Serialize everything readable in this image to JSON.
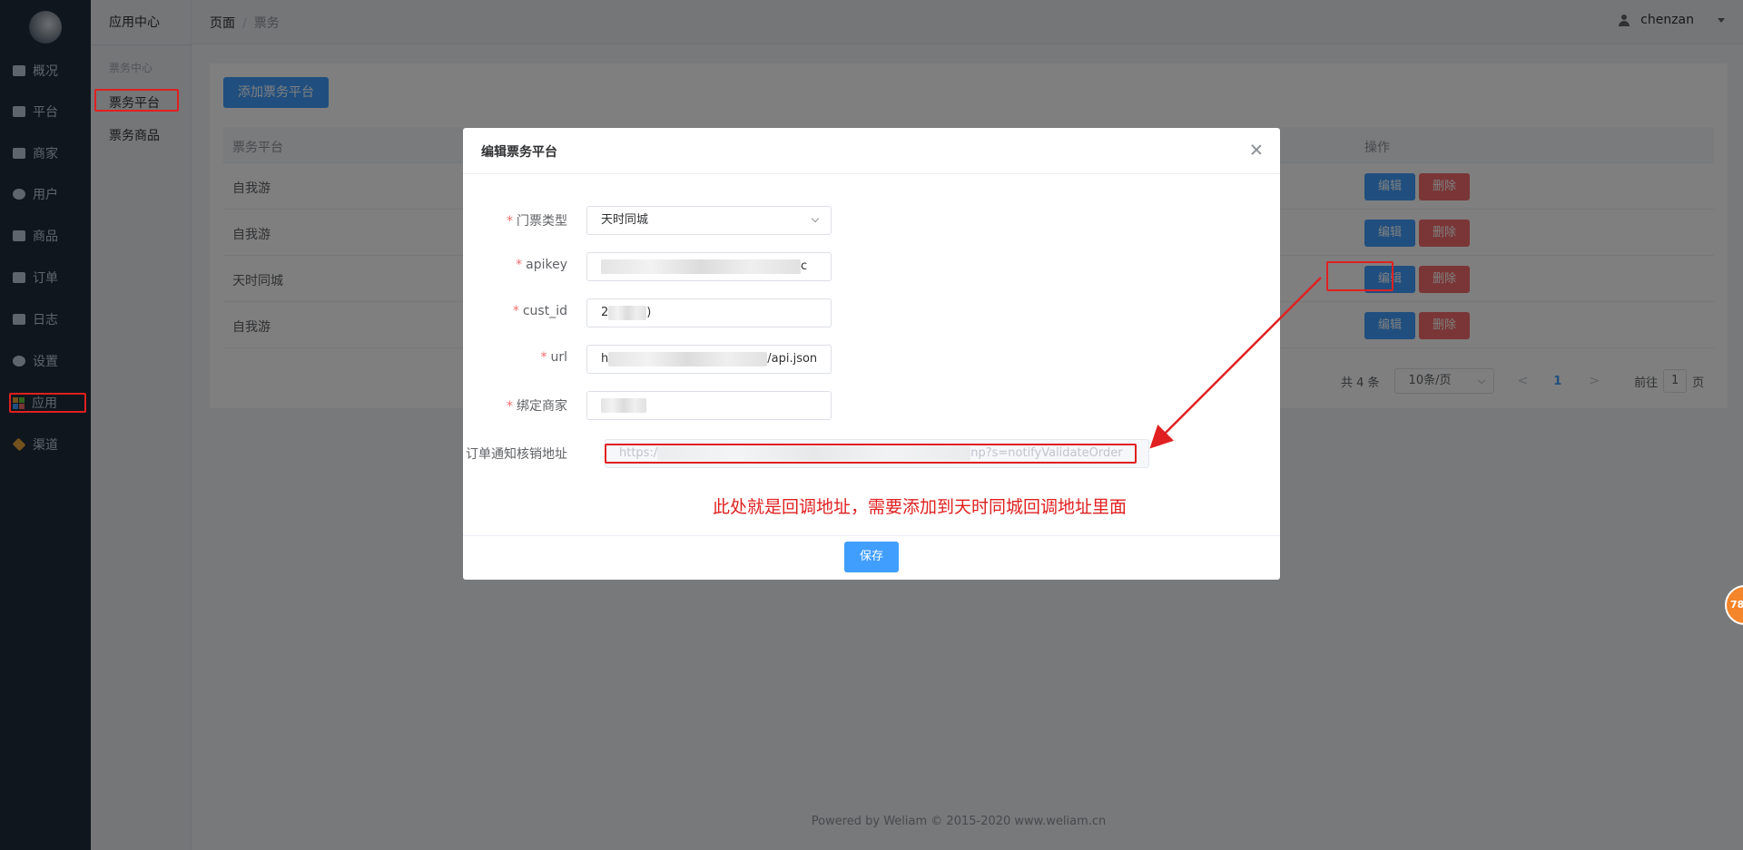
{
  "nav": {
    "items": [
      {
        "label": "概况",
        "icon": "chart-icon"
      },
      {
        "label": "平台",
        "icon": "monitor-icon"
      },
      {
        "label": "商家",
        "icon": "store-icon"
      },
      {
        "label": "用户",
        "icon": "user-icon"
      },
      {
        "label": "商品",
        "icon": "goods-icon"
      },
      {
        "label": "订单",
        "icon": "order-icon"
      },
      {
        "label": "日志",
        "icon": "log-icon"
      },
      {
        "label": "设置",
        "icon": "gear-icon"
      },
      {
        "label": "应用",
        "icon": "apps-icon"
      },
      {
        "label": "渠道",
        "icon": "cube-icon"
      }
    ]
  },
  "sub_sidebar": {
    "title": "应用中心",
    "group": "票务中心",
    "items": [
      "票务平台",
      "票务商品"
    ]
  },
  "header": {
    "breadcrumb": [
      "页面",
      "票务"
    ],
    "username": "chenzan"
  },
  "main": {
    "add_button": "添加票务平台",
    "columns": {
      "platform": "票务平台",
      "actions": "操作"
    },
    "rows": [
      {
        "platform": "自我游"
      },
      {
        "platform": "自我游"
      },
      {
        "platform": "天时同城"
      },
      {
        "platform": "自我游"
      }
    ],
    "edit_label": "编辑",
    "delete_label": "删除",
    "pagination": {
      "total": "共 4 条",
      "page_size": "10条/页",
      "prev": "<",
      "current": "1",
      "next": ">",
      "goto_prefix": "前往",
      "goto_value": "1",
      "goto_suffix": "页"
    }
  },
  "footer": "Powered by Weliam © 2015-2020 www.weliam.cn",
  "dialog": {
    "title": "编辑票务平台",
    "fields": {
      "ticket_type": {
        "label": "门票类型",
        "value": "天时同城"
      },
      "apikey": {
        "label": "apikey",
        "value_tail": "c"
      },
      "cust_id": {
        "label": "cust_id",
        "value_head": "2",
        "value_tail": ")"
      },
      "url": {
        "label": "url",
        "value_head": "h",
        "value_tail": "/api.json"
      },
      "merchant": {
        "label": "绑定商家"
      },
      "notify": {
        "label": "订单通知核销地址",
        "value_head": "https:/",
        "value_tail": "np?s=notifyValidateOrder"
      }
    },
    "save_button": "保存",
    "annotation": "此处就是回调地址，需要添加到天时同城回调地址里面"
  },
  "float_badge": "78",
  "colors": {
    "primary": "#409eff",
    "danger": "#f56c6c",
    "sidebar": "#1f2d3d",
    "annotation": "#e02020"
  }
}
